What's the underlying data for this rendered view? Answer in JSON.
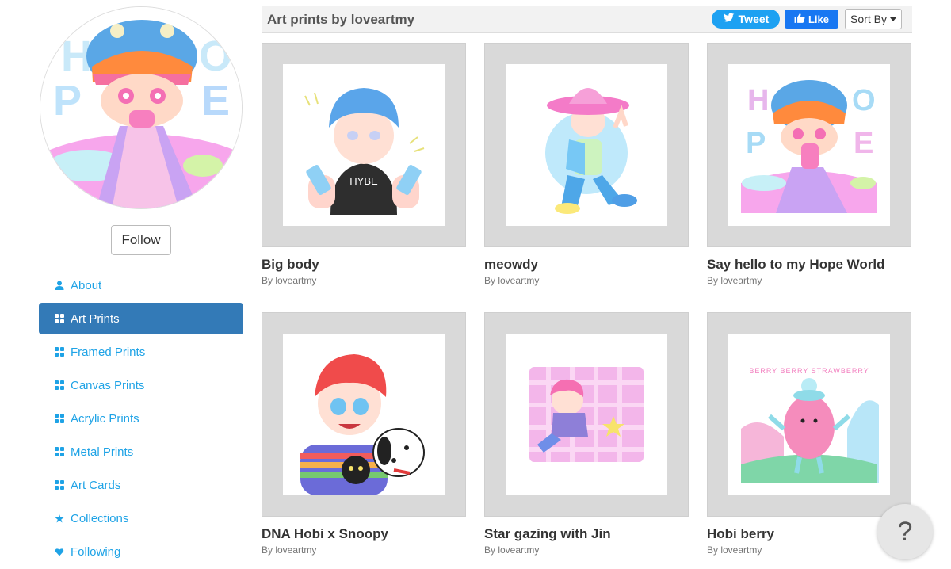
{
  "sidebar": {
    "follow_label": "Follow",
    "avatar_letters": [
      "H",
      "O",
      "P",
      "E"
    ],
    "items": [
      {
        "label": "About",
        "icon": "user-icon",
        "active": false
      },
      {
        "label": "Art Prints",
        "icon": "grid-icon",
        "active": true
      },
      {
        "label": "Framed Prints",
        "icon": "grid-icon",
        "active": false
      },
      {
        "label": "Canvas Prints",
        "icon": "grid-icon",
        "active": false
      },
      {
        "label": "Acrylic Prints",
        "icon": "grid-icon",
        "active": false
      },
      {
        "label": "Metal Prints",
        "icon": "grid-icon",
        "active": false
      },
      {
        "label": "Art Cards",
        "icon": "grid-icon",
        "active": false
      },
      {
        "label": "Collections",
        "icon": "star-icon",
        "active": false
      },
      {
        "label": "Following",
        "icon": "heart-icon",
        "active": false
      }
    ]
  },
  "header": {
    "title": "Art prints by loveartmy",
    "tweet_label": "Tweet",
    "like_label": "Like",
    "sort_label": "Sort By"
  },
  "products": [
    {
      "title": "Big body",
      "byline": "By loveartmy",
      "art_text": "HYBE"
    },
    {
      "title": "meowdy",
      "byline": "By loveartmy"
    },
    {
      "title": "Say hello to my Hope World",
      "byline": "By loveartmy",
      "art_letters": [
        "H",
        "O",
        "P",
        "E"
      ]
    },
    {
      "title": "DNA Hobi x Snoopy",
      "byline": "By loveartmy"
    },
    {
      "title": "Star gazing with Jin",
      "byline": "By loveartmy"
    },
    {
      "title": "Hobi berry",
      "byline": "By loveartmy",
      "art_text": "BERRY BERRY STRAWBERRY"
    }
  ],
  "help": {
    "label": "?"
  },
  "colors": {
    "accent_link": "#1fa3e6",
    "active_nav": "#337ab7",
    "tweet": "#1da1f2",
    "like": "#1877f2",
    "frame": "#d9d9d9"
  }
}
